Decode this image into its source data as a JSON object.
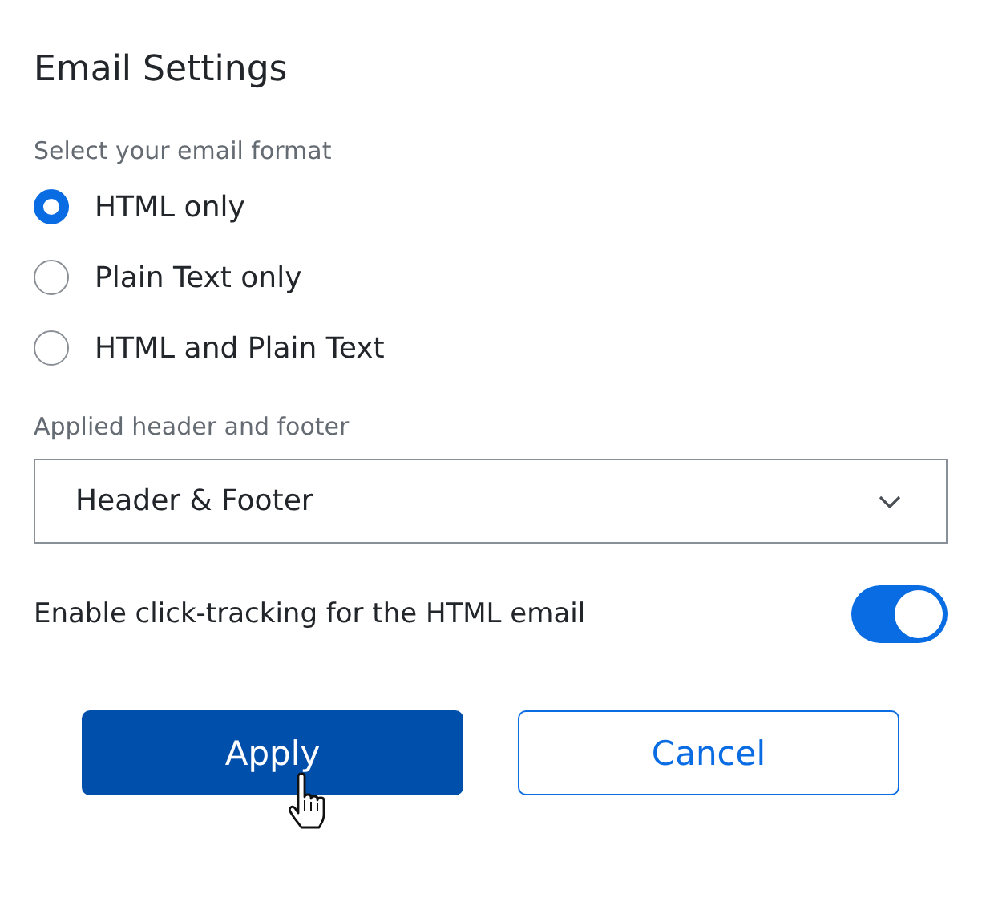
{
  "title": "Email Settings",
  "format": {
    "label": "Select your email format",
    "options": [
      {
        "label": "HTML only",
        "selected": true
      },
      {
        "label": "Plain Text only",
        "selected": false
      },
      {
        "label": "HTML and Plain Text",
        "selected": false
      }
    ]
  },
  "header_footer": {
    "label": "Applied header and footer",
    "value": "Header & Footer"
  },
  "click_tracking": {
    "label": "Enable click-tracking for the HTML email",
    "on": true
  },
  "buttons": [
    {
      "label": "Apply",
      "kind": "primary"
    },
    {
      "label": "Cancel",
      "kind": "secondary"
    }
  ]
}
